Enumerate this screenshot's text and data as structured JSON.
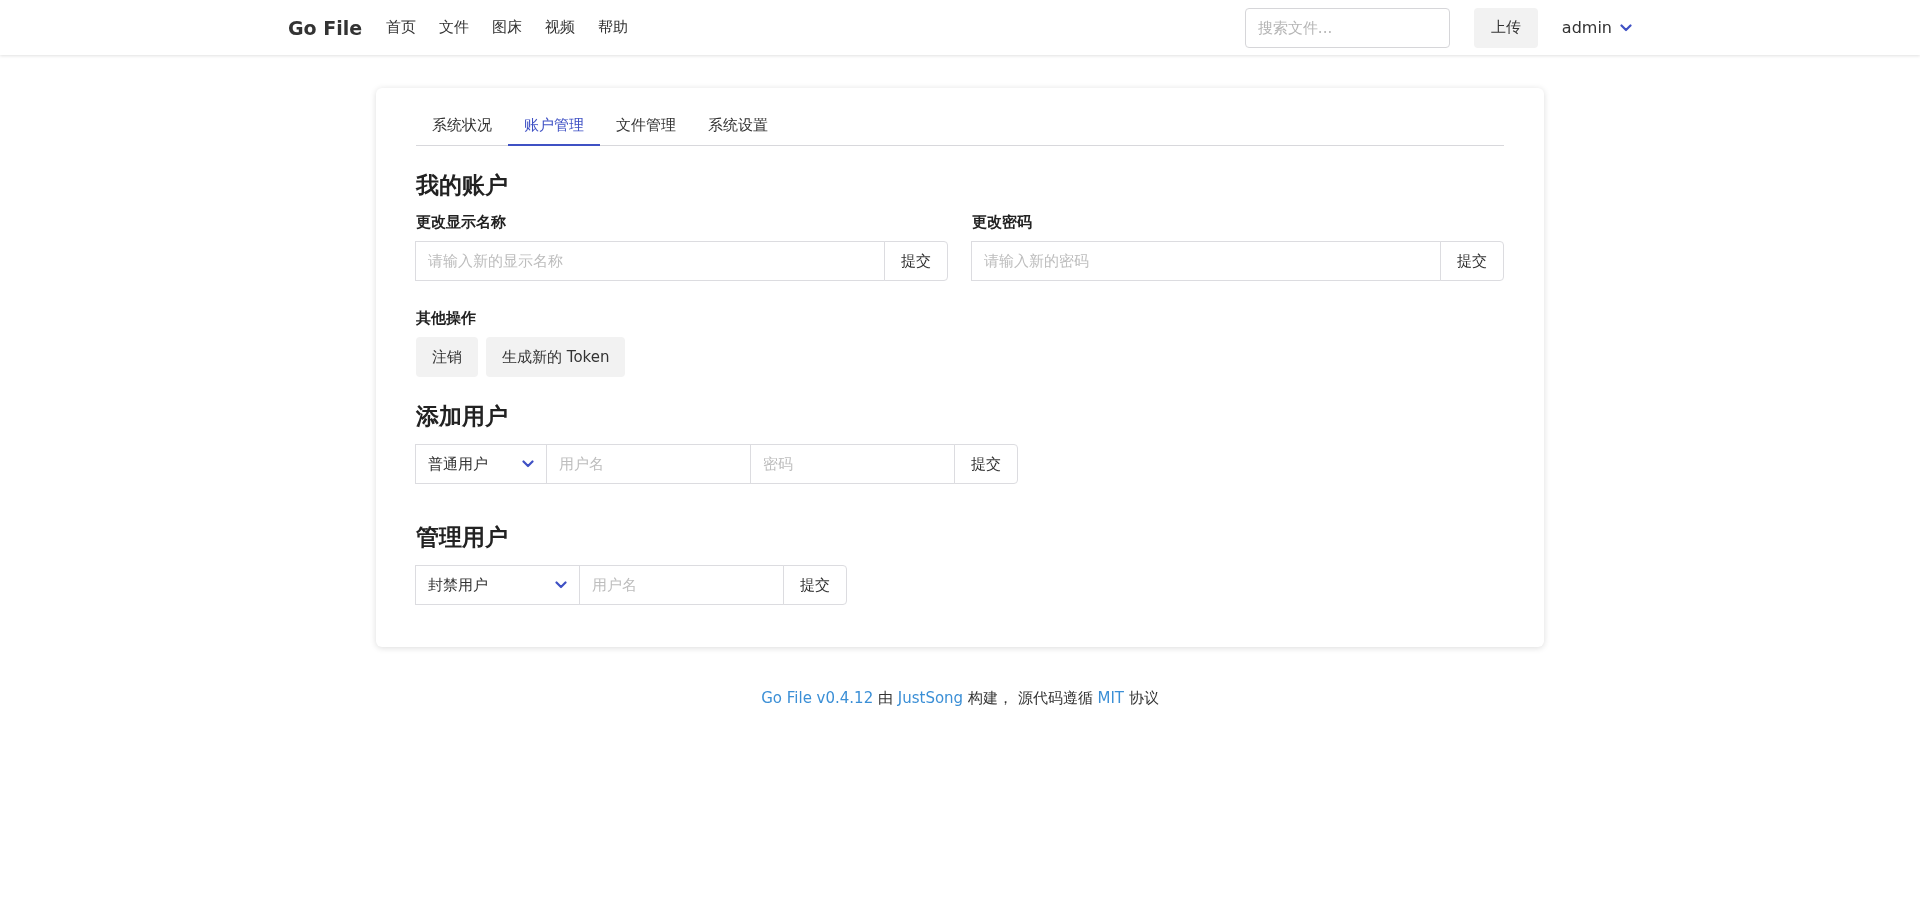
{
  "header": {
    "brand": "Go File",
    "nav": [
      "首页",
      "文件",
      "图床",
      "视频",
      "帮助"
    ],
    "search": {
      "placeholder": "搜索文件..."
    },
    "upload_button": "上传",
    "user_menu": "admin"
  },
  "tabs": [
    {
      "label": "系统状况",
      "selected": false
    },
    {
      "label": "账户管理",
      "selected": true
    },
    {
      "label": "文件管理",
      "selected": false
    },
    {
      "label": "系统设置",
      "selected": false
    }
  ],
  "my_account": {
    "title": "我的账户",
    "display_name": {
      "label": "更改显示名称",
      "placeholder": "请输入新的显示名称",
      "button": "提交"
    },
    "password": {
      "label": "更改密码",
      "placeholder": "请输入新的密码",
      "button": "提交"
    },
    "other_actions": {
      "label": "其他操作",
      "buttons": [
        "注销",
        "生成新的 Token"
      ]
    }
  },
  "add_user": {
    "title": "添加用户",
    "role_select": "普通用户",
    "username_placeholder": "用户名",
    "password_placeholder": "密码",
    "button": "提交"
  },
  "manage_user": {
    "title": "管理用户",
    "action_select": "封禁用户",
    "username_placeholder": "用户名",
    "button": "提交"
  },
  "footer": [
    {
      "kind": "link",
      "text": "Go File v0.4.12"
    },
    {
      "kind": "text",
      "text": "由"
    },
    {
      "kind": "link",
      "text": "JustSong"
    },
    {
      "kind": "text",
      "text": "构建， 源代码遵循"
    },
    {
      "kind": "link",
      "text": "MIT"
    },
    {
      "kind": "text",
      "text": "协议"
    }
  ]
}
